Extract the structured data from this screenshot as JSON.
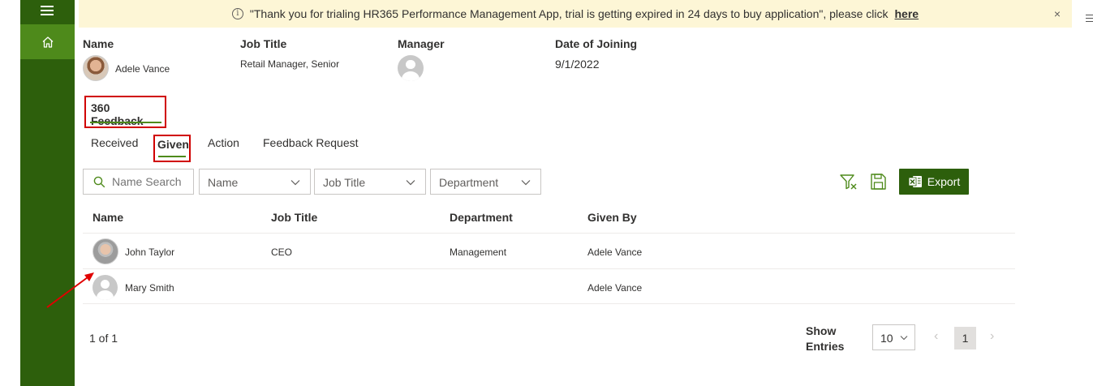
{
  "banner": {
    "message": "\"Thank you for trialing HR365 Performance Management App, trial is getting expired in 24 days to buy application\", please click",
    "link_text": "here",
    "close_glyph": "×",
    "info_glyph": "i"
  },
  "employee": {
    "name_label": "Name",
    "name_value": "Adele Vance",
    "job_title_label": "Job Title",
    "job_title_value": "Retail Manager, Senior",
    "manager_label": "Manager",
    "joining_label": "Date of Joining",
    "joining_value": "9/1/2022"
  },
  "section_tab": "360 Feedback",
  "subtabs": [
    {
      "label": "Received"
    },
    {
      "label": "Given",
      "selected": true
    },
    {
      "label": "Action"
    },
    {
      "label": "Feedback Request"
    }
  ],
  "filters": {
    "search_placeholder": "Name Search",
    "name_dropdown": "Name",
    "job_title_dropdown": "Job Title",
    "department_dropdown": "Department"
  },
  "toolbar": {
    "export_label": "Export"
  },
  "table": {
    "columns": [
      "Name",
      "Job Title",
      "Department",
      "Given By"
    ],
    "rows": [
      {
        "name": "John Taylor",
        "job_title": "CEO",
        "department": "Management",
        "given_by": "Adele Vance",
        "avatar": "photo"
      },
      {
        "name": "Mary Smith",
        "job_title": "",
        "department": "",
        "given_by": "Adele Vance",
        "avatar": "blank"
      }
    ]
  },
  "pagination": {
    "info": "1 of 1",
    "show_entries_label": "Show Entries",
    "page_size": "10",
    "current_page": "1",
    "prev_glyph": "‹",
    "next_glyph": "›"
  },
  "colors": {
    "sidebar": "#2d5f0c",
    "sidebar_active": "#4e8a1b",
    "accent": "#4e8a1b",
    "banner_bg": "#fdf6d6",
    "highlight_box": "#d00000"
  }
}
